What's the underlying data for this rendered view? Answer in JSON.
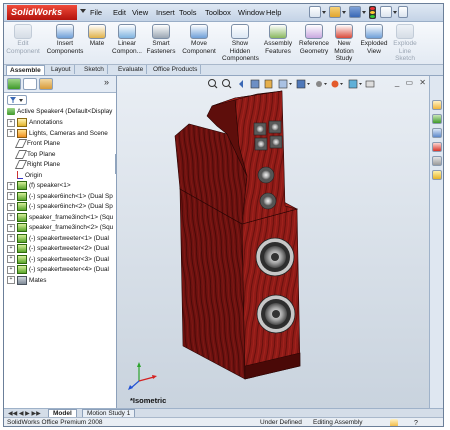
{
  "app": {
    "name": "SolidWorks"
  },
  "menu": [
    "File",
    "Edit",
    "View",
    "Insert",
    "Tools",
    "Toolbox",
    "Window",
    "Help"
  ],
  "toolbar": [
    {
      "label": "Edit\nComponent",
      "icon": "edit-component-icon",
      "enabled": false
    },
    {
      "label": "Insert\nComponents",
      "icon": "insert-components-icon",
      "enabled": true
    },
    {
      "label": "Mate",
      "icon": "mate-icon",
      "enabled": true
    },
    {
      "label": "Linear\nCompon...",
      "icon": "linear-pattern-icon",
      "enabled": true
    },
    {
      "label": "Smart\nFasteners",
      "icon": "smart-fasteners-icon",
      "enabled": true
    },
    {
      "label": "Move\nComponent",
      "icon": "move-component-icon",
      "enabled": true
    },
    {
      "label": "Show\nHidden\nComponents",
      "icon": "show-hidden-icon",
      "enabled": true
    },
    {
      "label": "Assembly\nFeatures",
      "icon": "assembly-features-icon",
      "enabled": true
    },
    {
      "label": "Reference\nGeometry",
      "icon": "reference-geometry-icon",
      "enabled": true
    },
    {
      "label": "New\nMotion\nStudy",
      "icon": "motion-study-icon",
      "enabled": true
    },
    {
      "label": "Exploded\nView",
      "icon": "exploded-view-icon",
      "enabled": true
    },
    {
      "label": "Explode\nLine\nSketch",
      "icon": "explode-line-icon",
      "enabled": false
    }
  ],
  "command_tabs": [
    "Assemble",
    "Layout",
    "Sketch",
    "Evaluate",
    "Office Products"
  ],
  "active_command_tab": "Assemble",
  "tree": {
    "root": "Active Speaker4  (Default<Display",
    "items": [
      {
        "label": "Annotations",
        "icon": "annotations-icon",
        "expander": "+"
      },
      {
        "label": "Lights, Cameras and Scene",
        "icon": "lights-icon",
        "expander": "+"
      },
      {
        "label": "Front Plane",
        "icon": "plane-icon",
        "expander": ""
      },
      {
        "label": "Top Plane",
        "icon": "plane-icon",
        "expander": ""
      },
      {
        "label": "Right Plane",
        "icon": "plane-icon",
        "expander": ""
      },
      {
        "label": "Origin",
        "icon": "origin-icon",
        "expander": ""
      },
      {
        "label": "(f) speaker<1>",
        "icon": "part-icon",
        "expander": "+"
      },
      {
        "label": "(-) speaker6inch<1> (Dual Sp",
        "icon": "part-icon",
        "expander": "+"
      },
      {
        "label": "(-) speaker6inch<2> (Dual Sp",
        "icon": "part-icon",
        "expander": "+"
      },
      {
        "label": "speaker_frame3inch<1> (Squ",
        "icon": "part-icon",
        "expander": "+"
      },
      {
        "label": "speaker_frame3inch<2> (Squ",
        "icon": "part-icon",
        "expander": "+"
      },
      {
        "label": "(-) speakertweeter<1> (Dual",
        "icon": "part-icon",
        "expander": "+"
      },
      {
        "label": "(-) speakertweeter<2> (Dual",
        "icon": "part-icon",
        "expander": "+"
      },
      {
        "label": "(-) speakertweeter<3> (Dual",
        "icon": "part-icon",
        "expander": "+"
      },
      {
        "label": "(-) speakertweeter<4> (Dual",
        "icon": "part-icon",
        "expander": "+"
      },
      {
        "label": "Mates",
        "icon": "mates-icon",
        "expander": "+"
      }
    ]
  },
  "viewport": {
    "view_label": "*Isometric"
  },
  "bottom_tabs": [
    "Model",
    "Motion Study 1"
  ],
  "active_bottom_tab": "Model",
  "status": {
    "product": "SolidWorks Office Premium 2008",
    "definition": "Under Defined",
    "mode": "Editing Assembly"
  },
  "colors": {
    "accent": "#b3120c",
    "speaker_wood": "#8c1a16",
    "tree_green": "#3f9a2a"
  }
}
